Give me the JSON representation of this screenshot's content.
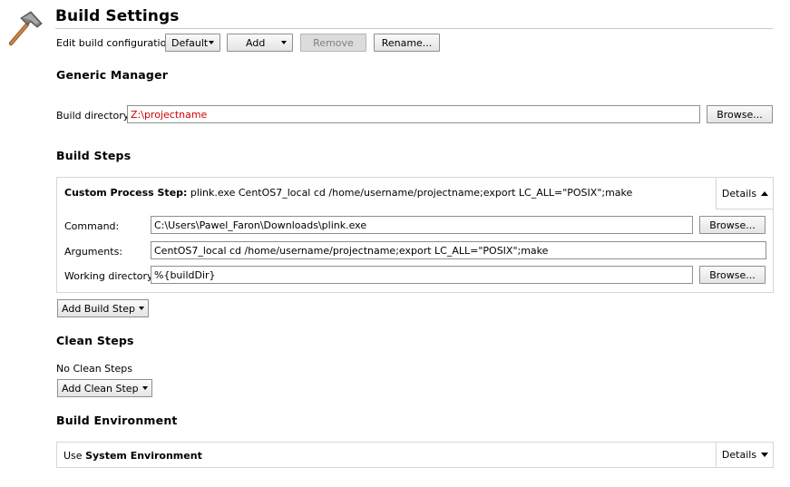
{
  "header": {
    "title": "Build Settings",
    "icon": "hammer-icon",
    "edit_config_label": "Edit build configuration:",
    "config_value": "Default",
    "add_label": "Add",
    "remove_label": "Remove",
    "rename_label": "Rename..."
  },
  "generic_manager": {
    "heading": "Generic Manager",
    "build_dir_label": "Build directory:",
    "build_dir_value": "Z:\\projectname",
    "browse_label": "Browse..."
  },
  "build_steps": {
    "heading": "Build Steps",
    "step_title_bold": "Custom Process Step:",
    "step_title_rest": "plink.exe CentOS7_local cd /home/username/projectname;export LC_ALL=\"POSIX\";make",
    "details_label": "Details",
    "command_label": "Command:",
    "command_value": "C:\\Users\\Pawel_Faron\\Downloads\\plink.exe",
    "command_browse": "Browse...",
    "arguments_label": "Arguments:",
    "arguments_value": "CentOS7_local cd /home/username/projectname;export LC_ALL=\"POSIX\";make",
    "workdir_label": "Working directory:",
    "workdir_value": "%{buildDir}",
    "workdir_browse": "Browse...",
    "add_step_label": "Add Build Step"
  },
  "clean_steps": {
    "heading": "Clean Steps",
    "empty_text": "No Clean Steps",
    "add_step_label": "Add Clean Step"
  },
  "build_environment": {
    "heading": "Build Environment",
    "use_prefix": "Use",
    "env_name": "System Environment",
    "details_label": "Details"
  },
  "colors": {
    "build_dir_text": "#cc0000",
    "panel_border": "#d6d6d6"
  }
}
